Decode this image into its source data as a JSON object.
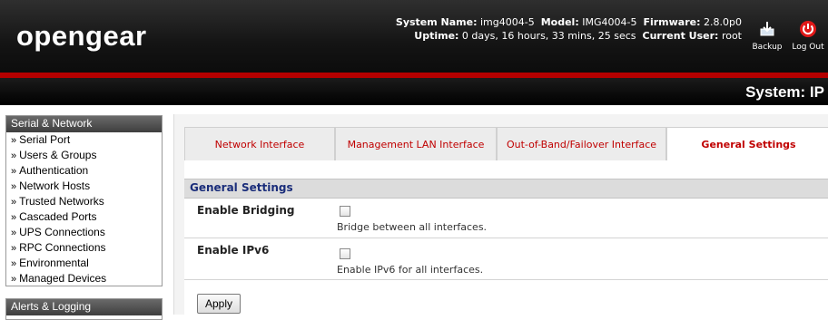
{
  "header": {
    "logo": "opengear",
    "system_name_label": "System Name:",
    "system_name": "img4004-5",
    "model_label": "Model:",
    "model": "IMG4004-5",
    "firmware_label": "Firmware:",
    "firmware": "2.8.0p0",
    "uptime_label": "Uptime:",
    "uptime": "0 days, 16 hours, 33 mins, 25 secs",
    "current_user_label": "Current User:",
    "current_user": "root",
    "backup_label": "Backup",
    "logout_label": "Log Out"
  },
  "page_title": "System: IP",
  "nav": {
    "serial_network": {
      "heading": "Serial & Network",
      "items": [
        {
          "label": "Serial Port"
        },
        {
          "label": "Users & Groups"
        },
        {
          "label": "Authentication"
        },
        {
          "label": "Network Hosts"
        },
        {
          "label": "Trusted Networks"
        },
        {
          "label": "Cascaded Ports"
        },
        {
          "label": "UPS Connections"
        },
        {
          "label": "RPC Connections"
        },
        {
          "label": "Environmental"
        },
        {
          "label": "Managed Devices"
        }
      ]
    },
    "alerts_logging": {
      "heading": "Alerts & Logging"
    },
    "arrow": "»"
  },
  "tabs": [
    {
      "label": "Network Interface"
    },
    {
      "label": "Management LAN Interface"
    },
    {
      "label": "Out-of-Band/Failover Interface"
    },
    {
      "label": "General Settings"
    }
  ],
  "section": {
    "heading": "General Settings",
    "settings": [
      {
        "label": "Enable Bridging",
        "description": "Bridge between all interfaces.",
        "checked": false
      },
      {
        "label": "Enable IPv6",
        "description": "Enable IPv6 for all interfaces.",
        "checked": false
      }
    ]
  },
  "apply_label": "Apply",
  "colors": {
    "accent_red": "#b40000",
    "tab_text": "#c00000",
    "section_heading": "#1a2d7a"
  }
}
